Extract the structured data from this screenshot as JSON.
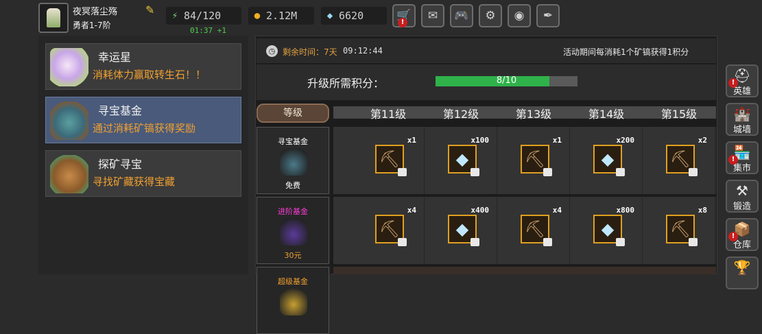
{
  "player": {
    "name": "夜冥落尘殇",
    "level": "勇者1-7阶"
  },
  "stats": {
    "stamina": "84/120",
    "stamina_timer": "01:37 +1",
    "gold": "2.12M",
    "diamonds": "6620"
  },
  "toolbar": {
    "buttons": [
      {
        "name": "shop-cart-button",
        "icon": "cart-icon",
        "glyph": "🛒",
        "badge": "!"
      },
      {
        "name": "mail-button",
        "icon": "mail-icon",
        "glyph": "✉",
        "badge": ""
      },
      {
        "name": "gamepad-button",
        "icon": "gamepad-icon",
        "glyph": "🎮",
        "badge": ""
      },
      {
        "name": "settings-button",
        "icon": "gear-icon",
        "glyph": "⚙",
        "badge": ""
      },
      {
        "name": "color-wheel-button",
        "icon": "color-wheel-icon",
        "glyph": "◉",
        "badge": ""
      },
      {
        "name": "feather-button",
        "icon": "feather-icon",
        "glyph": "✒",
        "badge": ""
      }
    ]
  },
  "events": [
    {
      "title": "幸运星",
      "desc": "消耗体力赢取转生石！！",
      "selected": false
    },
    {
      "title": "寻宝基金",
      "desc": "通过消耗矿镐获得奖励",
      "selected": true
    },
    {
      "title": "探矿寻宝",
      "desc": "寻找矿藏获得宝藏",
      "selected": false
    }
  ],
  "fund": {
    "remain_label": "剩余时间：7天",
    "remain_time": "09:12:44",
    "rule": "活动期间每消耗1个矿镐获得1积分",
    "upgrade_label": "升级所需积分：",
    "progress_text": "8/10",
    "progress_value": 0.8,
    "level_header": "等级",
    "levels": [
      "第11级",
      "第12级",
      "第13级",
      "第14级",
      "第15级"
    ],
    "tiers": [
      {
        "name": "寻宝基金",
        "price": "免费",
        "name_color": "#ffffff",
        "price_color": "#ffffff"
      },
      {
        "name": "进阶基金",
        "price": "30元",
        "name_color": "#ff3ad8",
        "price_color": "#f0a030"
      },
      {
        "name": "超级基金",
        "price": "",
        "name_color": "#f0a030",
        "price_color": "#f0a030"
      }
    ],
    "rewards": [
      [
        {
          "item": "pickaxe",
          "qty": "x1"
        },
        {
          "item": "diamond",
          "qty": "x100"
        },
        {
          "item": "pickaxe",
          "qty": "x1"
        },
        {
          "item": "diamond",
          "qty": "x200"
        },
        {
          "item": "pickaxe",
          "qty": "x2"
        }
      ],
      [
        {
          "item": "pickaxe",
          "qty": "x4"
        },
        {
          "item": "diamond",
          "qty": "x400"
        },
        {
          "item": "pickaxe",
          "qty": "x4"
        },
        {
          "item": "diamond",
          "qty": "x800"
        },
        {
          "item": "pickaxe",
          "qty": "x8"
        }
      ]
    ]
  },
  "right_nav": [
    {
      "label": "英雄",
      "icon": "helmet-icon",
      "glyph": "⛑",
      "badge": "!"
    },
    {
      "label": "城墙",
      "icon": "castle-wall-icon",
      "glyph": "🏰",
      "badge": ""
    },
    {
      "label": "集市",
      "icon": "market-icon",
      "glyph": "🏪",
      "badge": "!"
    },
    {
      "label": "锻造",
      "icon": "anvil-icon",
      "glyph": "⚒",
      "badge": ""
    },
    {
      "label": "仓库",
      "icon": "warehouse-icon",
      "glyph": "📦",
      "badge": "!"
    },
    {
      "label": "",
      "icon": "trophy-icon",
      "glyph": "🏆",
      "badge": ""
    }
  ]
}
